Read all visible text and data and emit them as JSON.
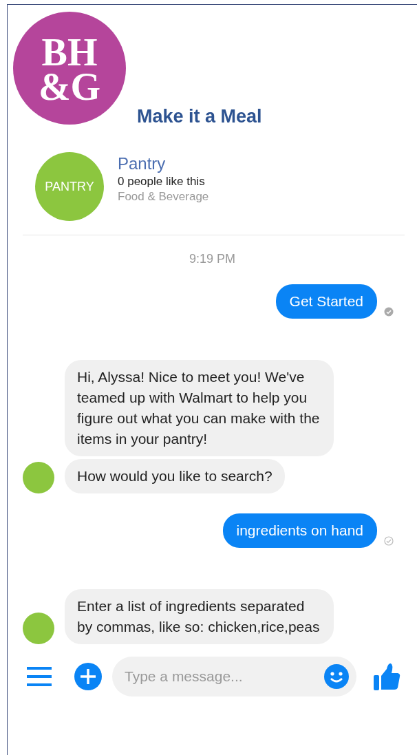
{
  "logo": {
    "line_1": "BH",
    "line_2": "&G"
  },
  "title": "Make it a Meal",
  "page": {
    "avatar_text": "PANTRY",
    "name": "Pantry",
    "likes": "0 people like this",
    "category": "Food & Beverage"
  },
  "timestamp": "9:19 PM",
  "messages": [
    {
      "kind": "outgoing",
      "text": "Get Started",
      "seen": true
    },
    {
      "kind": "incoming",
      "text": "Hi, Alyssa! Nice to meet you! We've teamed up with Walmart to help you figure out what you can make with the items in your pantry!",
      "avatar": false
    },
    {
      "kind": "incoming",
      "text": "How would you like to search?",
      "avatar": true
    },
    {
      "kind": "outgoing",
      "text": "ingredients on hand",
      "seen": false
    },
    {
      "kind": "incoming",
      "text": "Enter a list of ingredients separated by commas, like so: chicken,rice,peas",
      "avatar": true
    }
  ],
  "composer": {
    "placeholder": "Type a message..."
  }
}
